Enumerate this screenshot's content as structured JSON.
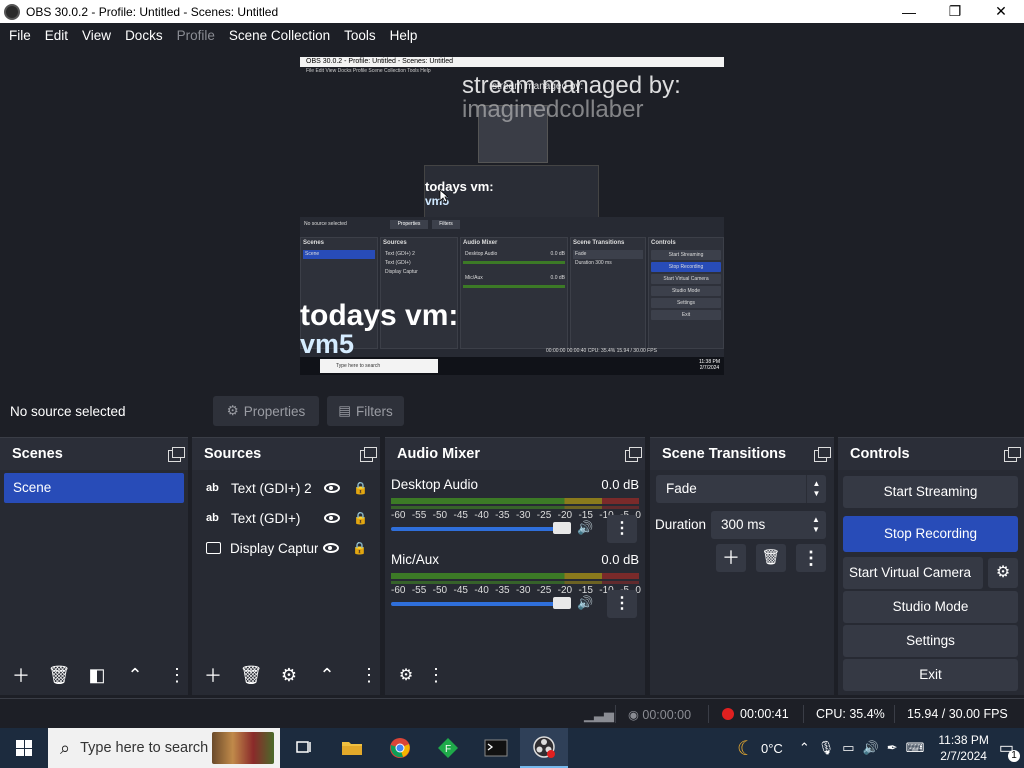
{
  "window": {
    "title": "OBS 30.0.2 - Profile: Untitled - Scenes: Untitled",
    "minimize": "—",
    "maximize": "❐",
    "close": "✕"
  },
  "menu": [
    "File",
    "Edit",
    "View",
    "Docks",
    "Profile",
    "Scene Collection",
    "Tools",
    "Help"
  ],
  "preview": {
    "overlay_text_1": "stream managed by:",
    "overlay_text_2": "imaginedcollaber",
    "nested_overlay_1": "stream managed by:",
    "caption_1": "todays vm:",
    "caption_2": "vm5",
    "nested_caption_1": "todays vm:",
    "nested_caption_2": "vm5",
    "mini_title": "OBS 30.0.2 - Profile: Untitled - Scenes: Untitled",
    "mini_menu": "File  Edit  View  Docks  Profile  Scene Collection  Tools  Help",
    "mini_no_source": "No source selected",
    "mini_properties": "Properties",
    "mini_filters": "Filters",
    "mini_scenes": "Scenes",
    "mini_scene": "Scene",
    "mini_sources": "Sources",
    "mini_src_1": "Text (GDI+) 2",
    "mini_src_2": "Text (GDI+)",
    "mini_src_3": "Display Captur",
    "mini_mixer": "Audio Mixer",
    "mini_desktop": "Desktop Audio",
    "mini_mic": "Mic/Aux",
    "mini_db": "0.0 dB",
    "mini_transitions": "Scene Transitions",
    "mini_fade": "Fade",
    "mini_duration": "Duration",
    "mini_dur_val": "300 ms",
    "mini_controls": "Controls",
    "mini_ctrl": [
      "Start Streaming",
      "Stop Recording",
      "Start Virtual Camera",
      "Studio Mode",
      "Settings",
      "Exit"
    ],
    "mini_status": "00:00:00    00:00:40    CPU: 35.4%    15.94 / 30.00 FPS",
    "mini_search": "Type here to search",
    "mini_clock": "11:38 PM\n2/7/2024"
  },
  "source_bar": {
    "no_source": "No source selected",
    "properties": "Properties",
    "filters": "Filters"
  },
  "scenes": {
    "title": "Scenes",
    "items": [
      "Scene"
    ]
  },
  "sources": {
    "title": "Sources",
    "items": [
      {
        "type": "ab",
        "name": "Text (GDI+) 2"
      },
      {
        "type": "ab",
        "name": "Text (GDI+)"
      },
      {
        "type": "display",
        "name": "Display Captur"
      }
    ]
  },
  "mixer": {
    "title": "Audio Mixer",
    "ticks": [
      "-60",
      "-55",
      "-50",
      "-45",
      "-40",
      "-35",
      "-30",
      "-25",
      "-20",
      "-15",
      "-10",
      "-5",
      "0"
    ],
    "channels": [
      {
        "name": "Desktop Audio",
        "db": "0.0 dB"
      },
      {
        "name": "Mic/Aux",
        "db": "0.0 dB"
      }
    ]
  },
  "transitions": {
    "title": "Scene Transitions",
    "selected": "Fade",
    "duration_label": "Duration",
    "duration_value": "300 ms"
  },
  "controls": {
    "title": "Controls",
    "start_streaming": "Start Streaming",
    "stop_recording": "Stop Recording",
    "virtual_camera": "Start Virtual Camera",
    "studio_mode": "Studio Mode",
    "settings": "Settings",
    "exit": "Exit"
  },
  "status": {
    "stream_time": "00:00:00",
    "rec_time": "00:00:41",
    "cpu": "CPU: 35.4%",
    "fps": "15.94 / 30.00 FPS"
  },
  "taskbar": {
    "search_placeholder": "Type here to search",
    "temperature": "0°C",
    "time": "11:38 PM",
    "date": "2/7/2024",
    "notifications": "1"
  },
  "colors": {
    "accent": "#284cb8",
    "background": "#1d1f26",
    "dock": "#272a33",
    "record": "#e02020"
  }
}
